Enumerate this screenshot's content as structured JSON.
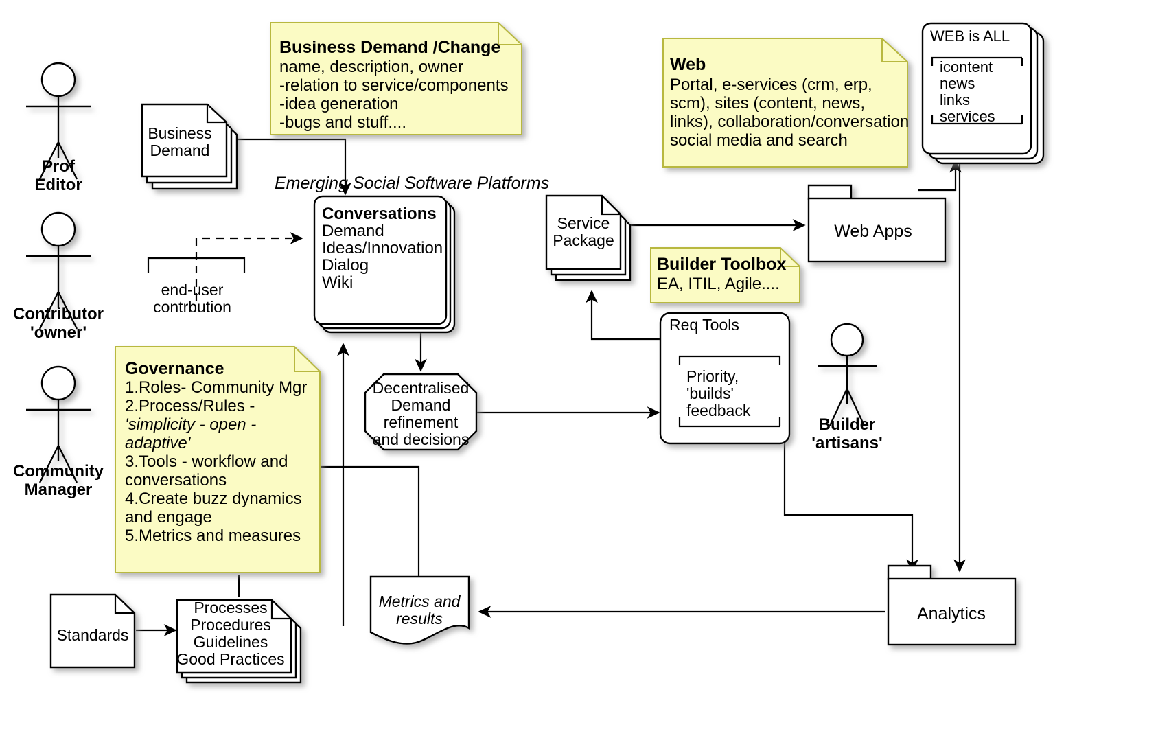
{
  "diagram": {
    "title_inline": "Emerging Social Software Platforms",
    "actors": [
      {
        "id": "prof-editor",
        "lines": [
          "Prof",
          "Editor"
        ]
      },
      {
        "id": "contributor-owner",
        "lines": [
          "Contributor",
          "'owner'"
        ]
      },
      {
        "id": "community-manager",
        "lines": [
          "Community",
          "Manager"
        ]
      },
      {
        "id": "builder-artisans",
        "lines": [
          "Builder",
          "'artisans'"
        ]
      }
    ],
    "notes": [
      {
        "id": "business-demand-change",
        "title": "Business Demand /Change",
        "lines": [
          "name, description, owner",
          "-relation to service/components",
          "-idea generation",
          "-bugs and stuff...."
        ]
      },
      {
        "id": "web",
        "title": "Web",
        "lines": [
          "Portal, e-services (crm, erp,",
          "scm), sites (content, news,",
          "links), collaboration/conversation",
          "social media and search"
        ]
      },
      {
        "id": "builder-toolbox",
        "title": "Builder Toolbox",
        "lines": [
          "EA, ITIL, Agile...."
        ]
      },
      {
        "id": "governance",
        "title": "Governance",
        "lines": [
          "1.Roles- Community Mgr",
          "2.Process/Rules -",
          "'simplicity - open -",
          "adaptive'",
          "3.Tools - workflow and",
          "conversations",
          "4.Create buzz dynamics",
          "and engage",
          "5.Metrics and measures"
        ],
        "italic_line_indexes": [
          2,
          3
        ]
      }
    ],
    "nodes": [
      {
        "id": "business-demand",
        "type": "stacked-document",
        "lines": [
          "Business",
          "Demand"
        ]
      },
      {
        "id": "conversations",
        "type": "stacked-rounded",
        "title": "Conversations",
        "lines": [
          "Demand",
          "Ideas/Innovation",
          "Dialog",
          "Wiki"
        ]
      },
      {
        "id": "end-user-contribution",
        "type": "bracket-label",
        "lines": [
          "end-user",
          "contrbution"
        ]
      },
      {
        "id": "decentralised-demand",
        "type": "octagon",
        "lines": [
          "Decentralised",
          "Demand",
          "refinement",
          "and decisions"
        ]
      },
      {
        "id": "service-package",
        "type": "stacked-document",
        "lines": [
          "Service",
          "Package"
        ]
      },
      {
        "id": "req-tools",
        "type": "rounded-framed",
        "title": "Req Tools",
        "lines": [
          "Priority,",
          "'builds'",
          "feedback"
        ]
      },
      {
        "id": "web-apps",
        "type": "package",
        "lines": [
          "Web Apps"
        ]
      },
      {
        "id": "web-is-all",
        "type": "stacked-rounded-framed",
        "title": "WEB is ALL",
        "lines": [
          "icontent",
          "news",
          "links",
          "services"
        ]
      },
      {
        "id": "analytics",
        "type": "package",
        "lines": [
          "Analytics"
        ]
      },
      {
        "id": "standards",
        "type": "document",
        "lines": [
          "Standards"
        ]
      },
      {
        "id": "processes",
        "type": "stacked-document",
        "lines": [
          "Processes",
          "Procedures",
          "Guidelines",
          "Good Practices"
        ]
      },
      {
        "id": "metrics-and-results",
        "type": "wave-document",
        "lines": [
          "Metrics and",
          "results"
        ]
      }
    ],
    "colors": {
      "note_fill": "#fbfbc4",
      "note_border": "#b8b840",
      "line": "#000000",
      "canvas": "#ffffff"
    }
  }
}
